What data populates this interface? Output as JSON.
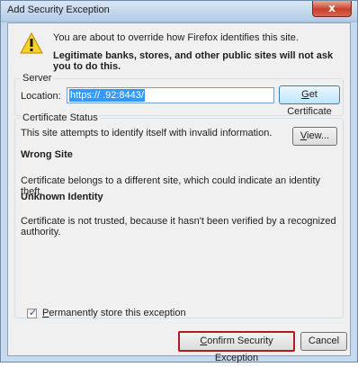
{
  "window": {
    "title": "Add Security Exception",
    "close_label": "x"
  },
  "intro": {
    "line1": "You are about to override how Firefox identifies this site.",
    "line2": "Legitimate banks, stores, and other public sites will not ask you to do this."
  },
  "server": {
    "group_label": "Server",
    "location_label": "Location:",
    "location_value": "https://            .92:8443/",
    "get_certificate_first": "G",
    "get_certificate_rest": "et Certificate"
  },
  "status": {
    "group_label": "Certificate Status",
    "line1": "This site attempts to identify itself with invalid information.",
    "view_first": "V",
    "view_rest": "iew...",
    "wrong_site": "Wrong Site",
    "belongs": "Certificate belongs to a different site, which could indicate an identity theft.",
    "unknown_identity": "Unknown Identity",
    "not_trusted": "Certificate is not trusted, because it hasn't been verified by a recognized authority."
  },
  "permanent": {
    "checked": true,
    "label_first": "P",
    "label_rest": "ermanently store this exception"
  },
  "buttons": {
    "confirm_first": "C",
    "confirm_rest": "onfirm Security Exception",
    "cancel": "Cancel"
  },
  "colors": {
    "accent_red": "#b11a1f",
    "selection_blue": "#3399ff",
    "warning_yellow": "#f7d12a"
  },
  "icons": {
    "warning": "warning-triangle-icon",
    "close": "close-icon",
    "checkmark": "checkmark-icon"
  }
}
